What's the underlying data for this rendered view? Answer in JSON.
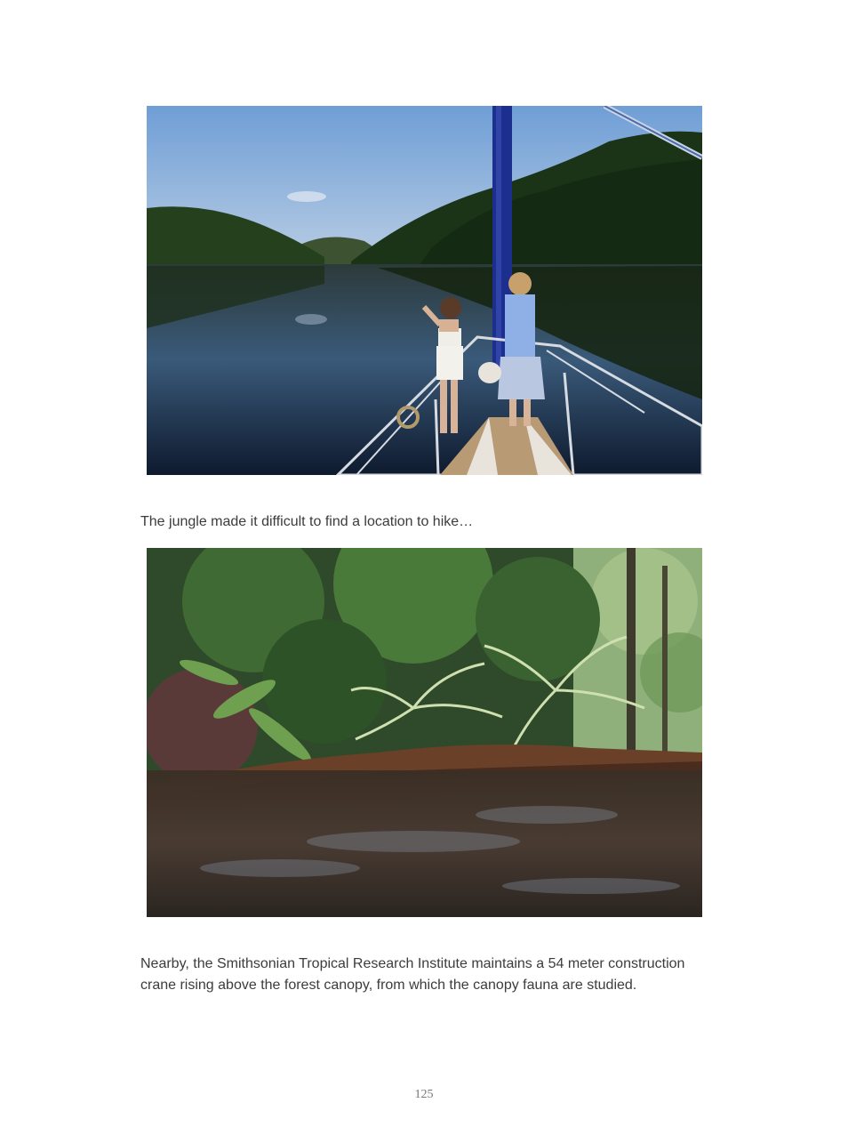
{
  "captions": {
    "first": "The jungle made it difficult to find a location to hike…",
    "second": "Nearby, the Smithsonian Tropical Research Institute maintains a 54 meter construction crane rising above the forest canopy, from which the canopy fauna are studied."
  },
  "page_number": "125"
}
